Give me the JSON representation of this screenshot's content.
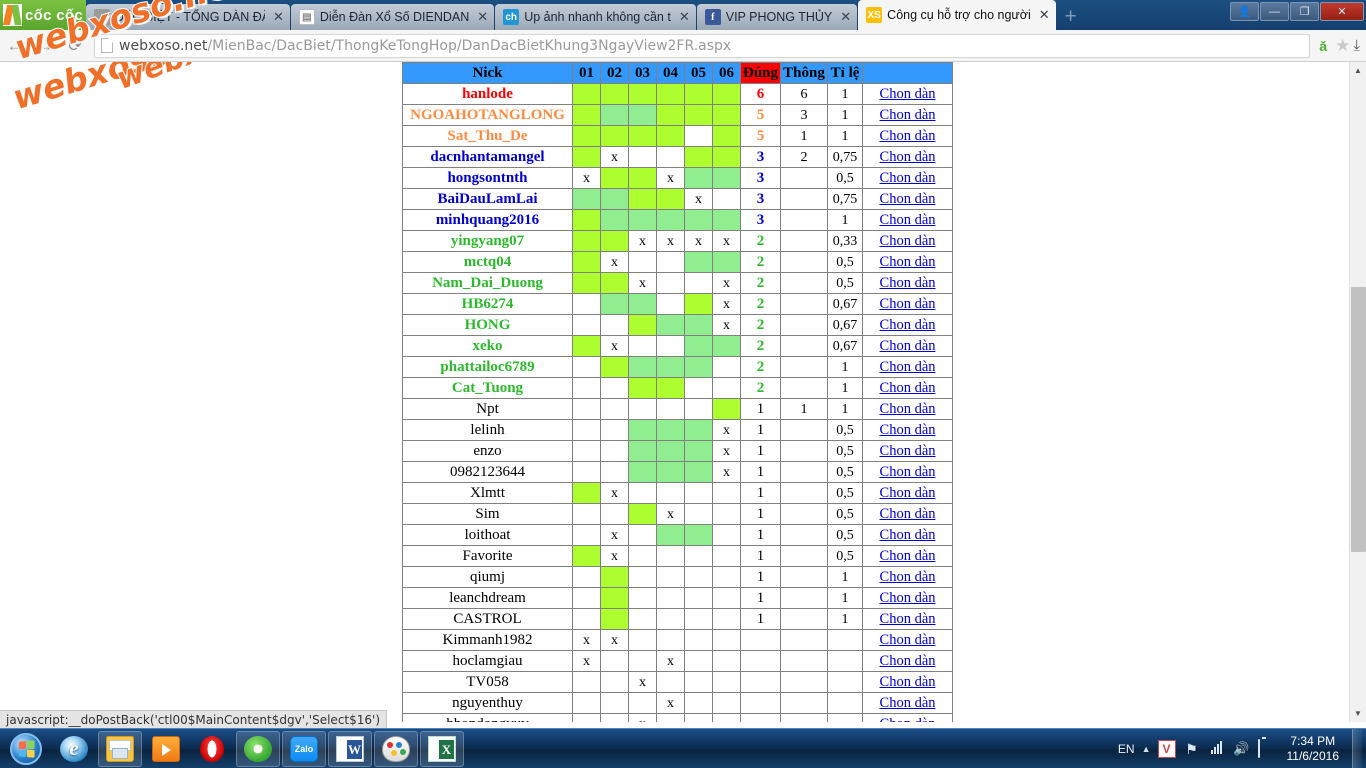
{
  "browser": {
    "name": "Cốc Cốc",
    "logo_text": "cốc cốc",
    "tabs": [
      {
        "title": "ĐẶC BIỆT - TỔNG DÀN ĐẶ",
        "favicon": "grey-doc-icon",
        "active": false,
        "close": "✕"
      },
      {
        "title": "Diễn Đàn Xổ Số DIENDAN",
        "favicon": "page-icon",
        "active": false,
        "close": "✕"
      },
      {
        "title": "Up ảnh nhanh không cần t",
        "favicon": "ch-icon",
        "active": false,
        "close": "✕"
      },
      {
        "title": "VIP PHONG THỦY",
        "favicon": "facebook-icon",
        "active": false,
        "close": "✕"
      },
      {
        "title": "Công cụ hỗ trợ cho người",
        "favicon": "xs-icon",
        "active": true,
        "close": "✕"
      }
    ],
    "new_tab_label": "+",
    "window_controls": {
      "user": "👤",
      "minimize": "—",
      "maximize": "❐",
      "close": "✕"
    },
    "nav": {
      "back": "←",
      "forward": "→",
      "reload": "⟳"
    },
    "url_host": "webxoso.net",
    "url_path": "/MienBac/DacBiet/ThongKeTongHop/DanDacBietKhung3NgayView2FR.aspx",
    "vietnamese_input_icon": "ă",
    "bookmark_icon": "★",
    "download_icon": "⤓"
  },
  "watermark": {
    "line1": "webxoso.net",
    "line2": "webxoso.net"
  },
  "status_bar": {
    "text": "javascript:__doPostBack('ctl00$MainContent$dgv','Select$16')"
  },
  "table": {
    "columns": [
      "Nick",
      "01",
      "02",
      "03",
      "04",
      "05",
      "06",
      "Đúng",
      "Thông",
      "Tỉ lệ",
      ""
    ],
    "action_label": "Chon dàn",
    "colors": {
      "header_bg": "#3399ff",
      "hot_header_bg": "#ff0000",
      "cell_bright": "#adff2f",
      "cell_light": "#90ee90",
      "link": "#0000cc"
    },
    "rows": [
      {
        "nick": "hanlode",
        "nick_color": "#ff0000",
        "cells": [
          "g1",
          "g1",
          "g1",
          "g1",
          "g1",
          "g1"
        ],
        "dung": "6",
        "dung_color": "#ff0000",
        "thong": "6",
        "tile": "1"
      },
      {
        "nick": "NGOAHOTANGLONG",
        "nick_color": "#ff8c42",
        "cells": [
          "g1",
          "g2",
          "g2",
          "g1",
          "g1",
          "g1"
        ],
        "dung": "5",
        "dung_color": "#ff8c42",
        "thong": "3",
        "tile": "1"
      },
      {
        "nick": "Sat_Thu_De",
        "nick_color": "#ff8c42",
        "cells": [
          "g1",
          "g1",
          "g1",
          "g1",
          "",
          "g1"
        ],
        "dung": "5",
        "dung_color": "#ff8c42",
        "thong": "1",
        "tile": "1"
      },
      {
        "nick": "dacnhantamangel",
        "nick_color": "#0000cc",
        "cells": [
          "g1",
          "x",
          "",
          "",
          "g1",
          "g1"
        ],
        "dung": "3",
        "dung_color": "#0000cc",
        "thong": "2",
        "tile": "0,75"
      },
      {
        "nick": "hongsontnth",
        "nick_color": "#0000cc",
        "cells": [
          "x",
          "g1",
          "g1",
          "x",
          "g2",
          "g2"
        ],
        "dung": "3",
        "dung_color": "#0000cc",
        "thong": "",
        "tile": "0,5"
      },
      {
        "nick": "BaiDauLamLai",
        "nick_color": "#0000cc",
        "cells": [
          "g2",
          "g2",
          "g1",
          "g1",
          "x",
          ""
        ],
        "dung": "3",
        "dung_color": "#0000cc",
        "thong": "",
        "tile": "0,75"
      },
      {
        "nick": "minhquang2016",
        "nick_color": "#0000cc",
        "cells": [
          "g1",
          "g2",
          "g2",
          "g2",
          "g2",
          "g2"
        ],
        "dung": "3",
        "dung_color": "#0000cc",
        "thong": "",
        "tile": "1"
      },
      {
        "nick": "yingyang07",
        "nick_color": "#2eb82e",
        "cells": [
          "g1",
          "g1",
          "x",
          "x",
          "x",
          "x"
        ],
        "dung": "2",
        "dung_color": "#2eb82e",
        "thong": "",
        "tile": "0,33"
      },
      {
        "nick": "mctq04",
        "nick_color": "#2eb82e",
        "cells": [
          "g1",
          "x",
          "",
          "",
          "g2",
          "g2"
        ],
        "dung": "2",
        "dung_color": "#2eb82e",
        "thong": "",
        "tile": "0,5"
      },
      {
        "nick": "Nam_Dai_Duong",
        "nick_color": "#2eb82e",
        "cells": [
          "g1",
          "g1",
          "x",
          "",
          "",
          "x"
        ],
        "dung": "2",
        "dung_color": "#2eb82e",
        "thong": "",
        "tile": "0,5"
      },
      {
        "nick": "HB6274",
        "nick_color": "#2eb82e",
        "cells": [
          "",
          "g2",
          "g2",
          "",
          "g1",
          "x"
        ],
        "dung": "2",
        "dung_color": "#2eb82e",
        "thong": "",
        "tile": "0,67"
      },
      {
        "nick": "HONG",
        "nick_color": "#2eb82e",
        "cells": [
          "",
          "",
          "g1",
          "g2",
          "g2",
          "x"
        ],
        "dung": "2",
        "dung_color": "#2eb82e",
        "thong": "",
        "tile": "0,67"
      },
      {
        "nick": "xeko",
        "nick_color": "#2eb82e",
        "cells": [
          "g1",
          "x",
          "",
          "",
          "g2",
          "g2"
        ],
        "dung": "2",
        "dung_color": "#2eb82e",
        "thong": "",
        "tile": "0,67"
      },
      {
        "nick": "phattailoc6789",
        "nick_color": "#2eb82e",
        "cells": [
          "",
          "g1",
          "g2",
          "g2",
          "g2",
          ""
        ],
        "dung": "2",
        "dung_color": "#2eb82e",
        "thong": "",
        "tile": "1"
      },
      {
        "nick": "Cat_Tuong",
        "nick_color": "#2eb82e",
        "cells": [
          "",
          "",
          "g1",
          "g1",
          "",
          ""
        ],
        "dung": "2",
        "dung_color": "#2eb82e",
        "thong": "",
        "tile": "1"
      },
      {
        "nick": "Npt",
        "nick_color": "#000000",
        "cells": [
          "",
          "",
          "",
          "",
          "",
          "g1"
        ],
        "dung": "1",
        "dung_color": "#000000",
        "thong": "1",
        "tile": "1"
      },
      {
        "nick": "lelinh",
        "nick_color": "#000000",
        "cells": [
          "",
          "",
          "g2",
          "g2",
          "g2",
          "x"
        ],
        "dung": "1",
        "dung_color": "#000000",
        "thong": "",
        "tile": "0,5"
      },
      {
        "nick": "enzo",
        "nick_color": "#000000",
        "cells": [
          "",
          "",
          "g2",
          "g2",
          "g2",
          "x"
        ],
        "dung": "1",
        "dung_color": "#000000",
        "thong": "",
        "tile": "0,5"
      },
      {
        "nick": "0982123644",
        "nick_color": "#000000",
        "cells": [
          "",
          "",
          "g2",
          "g2",
          "g2",
          "x"
        ],
        "dung": "1",
        "dung_color": "#000000",
        "thong": "",
        "tile": "0,5"
      },
      {
        "nick": "Xlmtt",
        "nick_color": "#000000",
        "cells": [
          "g1",
          "x",
          "",
          "",
          "",
          ""
        ],
        "dung": "1",
        "dung_color": "#000000",
        "thong": "",
        "tile": "0,5"
      },
      {
        "nick": "Sim",
        "nick_color": "#000000",
        "cells": [
          "",
          "",
          "g1",
          "x",
          "",
          ""
        ],
        "dung": "1",
        "dung_color": "#000000",
        "thong": "",
        "tile": "0,5"
      },
      {
        "nick": "loithoat",
        "nick_color": "#000000",
        "cells": [
          "",
          "x",
          "",
          "g2",
          "g2",
          ""
        ],
        "dung": "1",
        "dung_color": "#000000",
        "thong": "",
        "tile": "0,5"
      },
      {
        "nick": "Favorite",
        "nick_color": "#000000",
        "cells": [
          "g1",
          "x",
          "",
          "",
          "",
          ""
        ],
        "dung": "1",
        "dung_color": "#000000",
        "thong": "",
        "tile": "0,5"
      },
      {
        "nick": "qiumj",
        "nick_color": "#000000",
        "cells": [
          "",
          "g1",
          "",
          "",
          "",
          ""
        ],
        "dung": "1",
        "dung_color": "#000000",
        "thong": "",
        "tile": "1"
      },
      {
        "nick": "leanchdream",
        "nick_color": "#000000",
        "cells": [
          "",
          "g1",
          "",
          "",
          "",
          ""
        ],
        "dung": "1",
        "dung_color": "#000000",
        "thong": "",
        "tile": "1"
      },
      {
        "nick": "CASTROL",
        "nick_color": "#000000",
        "cells": [
          "",
          "g1",
          "",
          "",
          "",
          ""
        ],
        "dung": "1",
        "dung_color": "#000000",
        "thong": "",
        "tile": "1"
      },
      {
        "nick": "Kimmanh1982",
        "nick_color": "#000000",
        "cells": [
          "x",
          "x",
          "",
          "",
          "",
          ""
        ],
        "dung": "",
        "dung_color": "#000000",
        "thong": "",
        "tile": ""
      },
      {
        "nick": "hoclamgiau",
        "nick_color": "#000000",
        "cells": [
          "x",
          "",
          "",
          "x",
          "",
          ""
        ],
        "dung": "",
        "dung_color": "#000000",
        "thong": "",
        "tile": ""
      },
      {
        "nick": "TV058",
        "nick_color": "#000000",
        "cells": [
          "",
          "",
          "x",
          "",
          "",
          ""
        ],
        "dung": "",
        "dung_color": "#000000",
        "thong": "",
        "tile": ""
      },
      {
        "nick": "nguyenthuy",
        "nick_color": "#000000",
        "cells": [
          "",
          "",
          "",
          "x",
          "",
          ""
        ],
        "dung": "",
        "dung_color": "#000000",
        "thong": "",
        "tile": ""
      },
      {
        "nick": "hhondongvuv",
        "nick_color": "#000000",
        "cells": [
          "",
          "",
          "x",
          "",
          "",
          ""
        ],
        "dung": "",
        "dung_color": "#000000",
        "thong": "",
        "tile": ""
      }
    ]
  },
  "taskbar": {
    "start_label": "Start",
    "items": [
      {
        "icon": "internet-explorer-icon",
        "pinned": false
      },
      {
        "icon": "file-explorer-icon",
        "pinned": true
      },
      {
        "icon": "windows-media-player-icon",
        "pinned": false
      },
      {
        "icon": "opera-browser-icon",
        "pinned": false
      },
      {
        "icon": "coc-coc-browser-icon",
        "pinned": true
      },
      {
        "icon": "zalo-icon",
        "pinned": true
      },
      {
        "icon": "microsoft-word-icon",
        "pinned": true
      },
      {
        "icon": "paint-icon",
        "pinned": true
      },
      {
        "icon": "microsoft-excel-icon",
        "pinned": true
      }
    ],
    "tray": {
      "language": "EN",
      "show_hidden": "▲",
      "antivirus_icon": "V",
      "network_icon": "⚑",
      "signal_icon": "signal-bars-icon",
      "volume_icon": "🔊",
      "battery_icon": "battery-icon",
      "time": "7:34 PM",
      "date": "11/6/2016"
    }
  }
}
